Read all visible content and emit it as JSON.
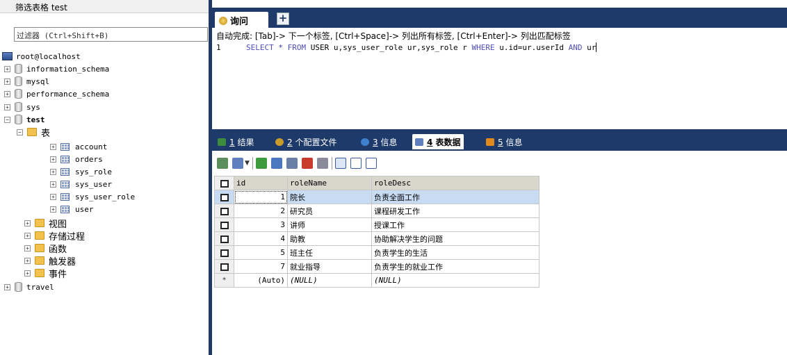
{
  "left_panel": {
    "title": "筛选表格 test",
    "filter_placeholder": "过滤器 (Ctrl+Shift+B)",
    "connection": "root@localhost",
    "databases": [
      "information_schema",
      "mysql",
      "performance_schema",
      "sys",
      "test",
      "travel"
    ],
    "test_folder": "表",
    "tables": [
      "account",
      "orders",
      "sys_role",
      "sys_user",
      "sys_user_role",
      "user"
    ],
    "folders": [
      "视图",
      "存储过程",
      "函数",
      "触发器",
      "事件"
    ]
  },
  "query_tab": {
    "label": "询问",
    "add_label": "+"
  },
  "editor": {
    "hint": "自动完成: [Tab]-> 下一个标签, [Ctrl+Space]-> 列出所有标签, [Ctrl+Enter]-> 列出匹配标签",
    "line_no": "1",
    "sql_parts": [
      "SELECT",
      " * ",
      "FROM",
      " USER u,sys_user_role ur,sys_role r ",
      "WHERE",
      " u.id=ur.userId ",
      "AND",
      " ur"
    ]
  },
  "result_tabs": [
    {
      "num": "1",
      "label": "结果"
    },
    {
      "num": "2",
      "label": "个配置文件"
    },
    {
      "num": "3",
      "label": "信息"
    },
    {
      "num": "4",
      "label": "表数据"
    },
    {
      "num": "5",
      "label": "信息"
    }
  ],
  "grid": {
    "columns": [
      "id",
      "roleName",
      "roleDesc"
    ],
    "rows": [
      {
        "id": "1",
        "roleName": "院长",
        "roleDesc": "负责全面工作"
      },
      {
        "id": "2",
        "roleName": "研究员",
        "roleDesc": "课程研发工作"
      },
      {
        "id": "3",
        "roleName": "讲师",
        "roleDesc": "授课工作"
      },
      {
        "id": "4",
        "roleName": "助教",
        "roleDesc": "协助解决学生的问题"
      },
      {
        "id": "5",
        "roleName": "班主任",
        "roleDesc": "负责学生的生活"
      },
      {
        "id": "7",
        "roleName": "就业指导",
        "roleDesc": "负责学生的就业工作"
      }
    ],
    "new_row": {
      "marker": "*",
      "id": "(Auto)",
      "roleName": "(NULL)",
      "roleDesc": "(NULL)"
    }
  },
  "colors": {
    "header_bar": "#1e3a6a",
    "selected_row": "#c7dcf3",
    "grid_header": "#d9d6cc"
  }
}
